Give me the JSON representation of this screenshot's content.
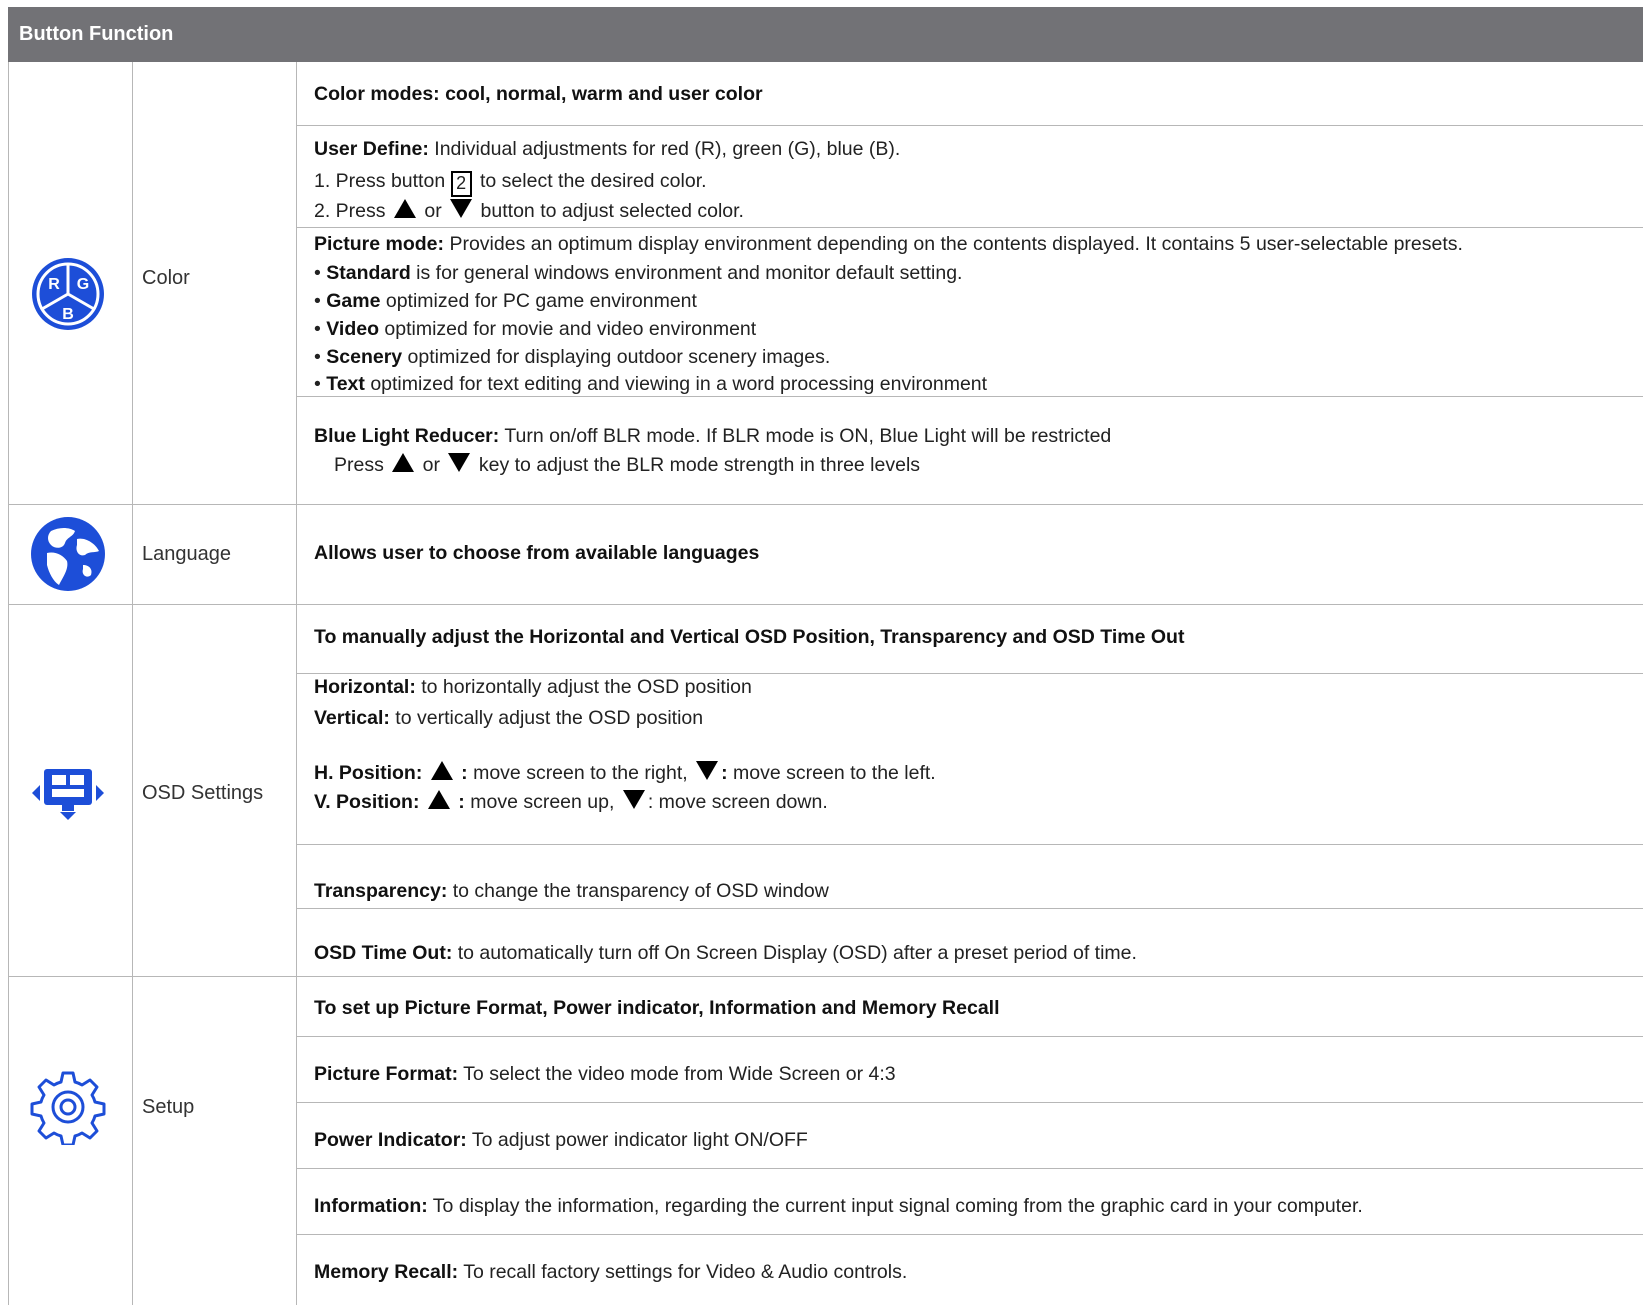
{
  "header": {
    "title": "Button Function"
  },
  "sections": {
    "color": {
      "label": "Color",
      "icon": "rgb-color-icon",
      "icon_letters": [
        "R",
        "G",
        "B"
      ],
      "heading": "Color modes:  cool, normal, warm and user color",
      "user_define": {
        "title": "User Define:",
        "desc": " Individual adjustments for red (R), green (G), blue (B).",
        "step1_prefix": "1. Press button ",
        "step1_key": "2",
        "step1_suffix": " to select the desired color.",
        "step2_prefix": "2. Press ",
        "step2_or": " or ",
        "step2_suffix": " button to adjust selected color."
      },
      "picture_mode": {
        "title": "Picture mode:",
        "desc": " Provides an optimum display environment depending on the contents displayed. It contains 5 user-selectable presets.",
        "items": [
          {
            "name": "Standard",
            "desc": " is for general windows environment and monitor default setting."
          },
          {
            "name": "Game",
            "desc": " optimized for PC game environment"
          },
          {
            "name": "Video",
            "desc": " optimized for movie and video environment"
          },
          {
            "name": "Scenery",
            "desc": " optimized for displaying outdoor scenery images."
          },
          {
            "name": "Text",
            "desc": " optimized for text editing and viewing in a word processing environment"
          }
        ],
        "bullet": "• "
      },
      "blr": {
        "title": "Blue Light Reducer:",
        "desc": " Turn on/off BLR mode. If BLR mode is ON, Blue Light will be restricted",
        "press": "Press ",
        "or": " or ",
        "suffix": "  key to adjust the BLR mode strength in three levels"
      }
    },
    "language": {
      "label": "Language",
      "icon": "globe-icon",
      "text": "Allows user to choose from available languages"
    },
    "osd": {
      "label": "OSD Settings",
      "icon": "osd-monitor-icon",
      "heading": "To manually adjust the Horizontal and Vertical OSD Position, Transparency and OSD Time Out",
      "horizontal_title": "Horizontal:",
      "horizontal_desc": " to horizontally adjust the OSD position",
      "vertical_title": "Vertical:",
      "vertical_desc": " to vertically adjust the OSD position",
      "hpos_title": "H. Position: ",
      "hpos_up_colon": " :",
      "hpos_up_desc": " move screen to the right, ",
      "hpos_down_colon": ":",
      "hpos_down_desc": "  move screen to the left.",
      "vpos_title": "V. Position:  ",
      "vpos_up_colon": " :",
      "vpos_up_desc": " move screen up, ",
      "vpos_down_desc": ": move screen down.",
      "transparency_title": "Transparency:",
      "transparency_desc": " to change the transparency of OSD window",
      "timeout_title": "OSD Time Out:",
      "timeout_desc": " to automatically turn off On Screen Display (OSD) after a preset period of time."
    },
    "setup": {
      "label": "Setup",
      "icon": "gear-icon",
      "heading": "To set up Picture Format, Power indicator, Information and Memory Recall",
      "rows": [
        {
          "title": "Picture Format:",
          "desc": " To select the video mode from Wide Screen or 4:3"
        },
        {
          "title": "Power Indicator:",
          "desc": " To adjust power indicator light ON/OFF"
        },
        {
          "title": "Information:",
          "desc": " To display the information, regarding the current input signal coming from the graphic card in your computer."
        },
        {
          "title": "Memory Recall:",
          "desc": " To recall factory settings for Video & Audio controls."
        }
      ]
    }
  },
  "colors": {
    "header_bg": "#727276",
    "icon_blue": "#1d4ed8",
    "grid": "#b7b7b7"
  }
}
